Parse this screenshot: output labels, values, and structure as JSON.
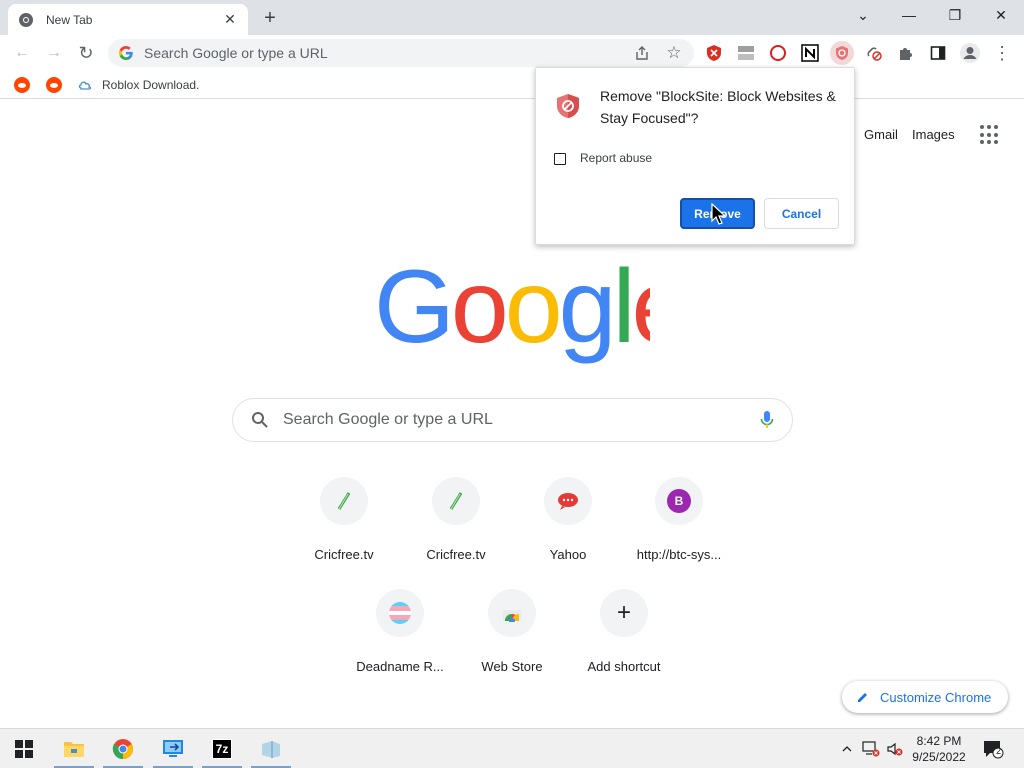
{
  "tab": {
    "title": "New Tab",
    "close": "✕"
  },
  "new_tab": "+",
  "window_controls": {
    "tabsearch": "⌄",
    "minimize": "—",
    "restore": "❐",
    "close": "✕"
  },
  "toolbar": {
    "back": "←",
    "forward": "→",
    "reload": "↻",
    "omnibox_placeholder": "Search Google or type a URL",
    "share_icon": "share-icon",
    "bookmark_star": "☆",
    "extensions": [
      "shield-extension",
      "stack-extension",
      "opera-ring-extension",
      "notion-extension",
      "blocksite-extension",
      "link-off-extension",
      "puzzle-icon"
    ],
    "side_panel": "side-panel-icon",
    "profile": "profile-icon",
    "menu": "⋮"
  },
  "bookmarks": [
    {
      "label": "",
      "icon": "reddit-icon"
    },
    {
      "label": "",
      "icon": "reddit-icon"
    },
    {
      "label": "Roblox Download.",
      "icon": "cloud-icon"
    }
  ],
  "top_links": {
    "gmail": "Gmail",
    "images": "Images"
  },
  "search": {
    "placeholder": "Search Google or type a URL"
  },
  "shortcuts": [
    {
      "label": "Cricfree.tv",
      "icon": "cricfree-icon"
    },
    {
      "label": "Cricfree.tv",
      "icon": "cricfree-icon"
    },
    {
      "label": "Yahoo",
      "icon": "yahoo-icon"
    },
    {
      "label": "http://btc-sys...",
      "icon": "letter-b-icon",
      "letter": "B"
    },
    {
      "label": "Deadname R...",
      "icon": "trans-flag-icon"
    },
    {
      "label": "Web Store",
      "icon": "web-store-icon"
    },
    {
      "label": "Add shortcut",
      "icon": "plus-icon",
      "symbol": "+"
    }
  ],
  "customize": {
    "label": "Customize Chrome"
  },
  "dialog": {
    "title": "Remove \"BlockSite: Block Websites & Stay Focused\"?",
    "checkbox_label": "Report abuse",
    "checkbox_checked": false,
    "remove_label": "Remove",
    "cancel_label": "Cancel"
  },
  "taskbar": {
    "time": "8:42 PM",
    "date": "9/25/2022",
    "notification_count": "2",
    "sevenzip_label": "7z"
  },
  "colors": {
    "accent": "#1a73e8",
    "google_blue": "#4285f4",
    "google_red": "#ea4335",
    "google_yellow": "#fbbc05",
    "google_green": "#34a853"
  }
}
